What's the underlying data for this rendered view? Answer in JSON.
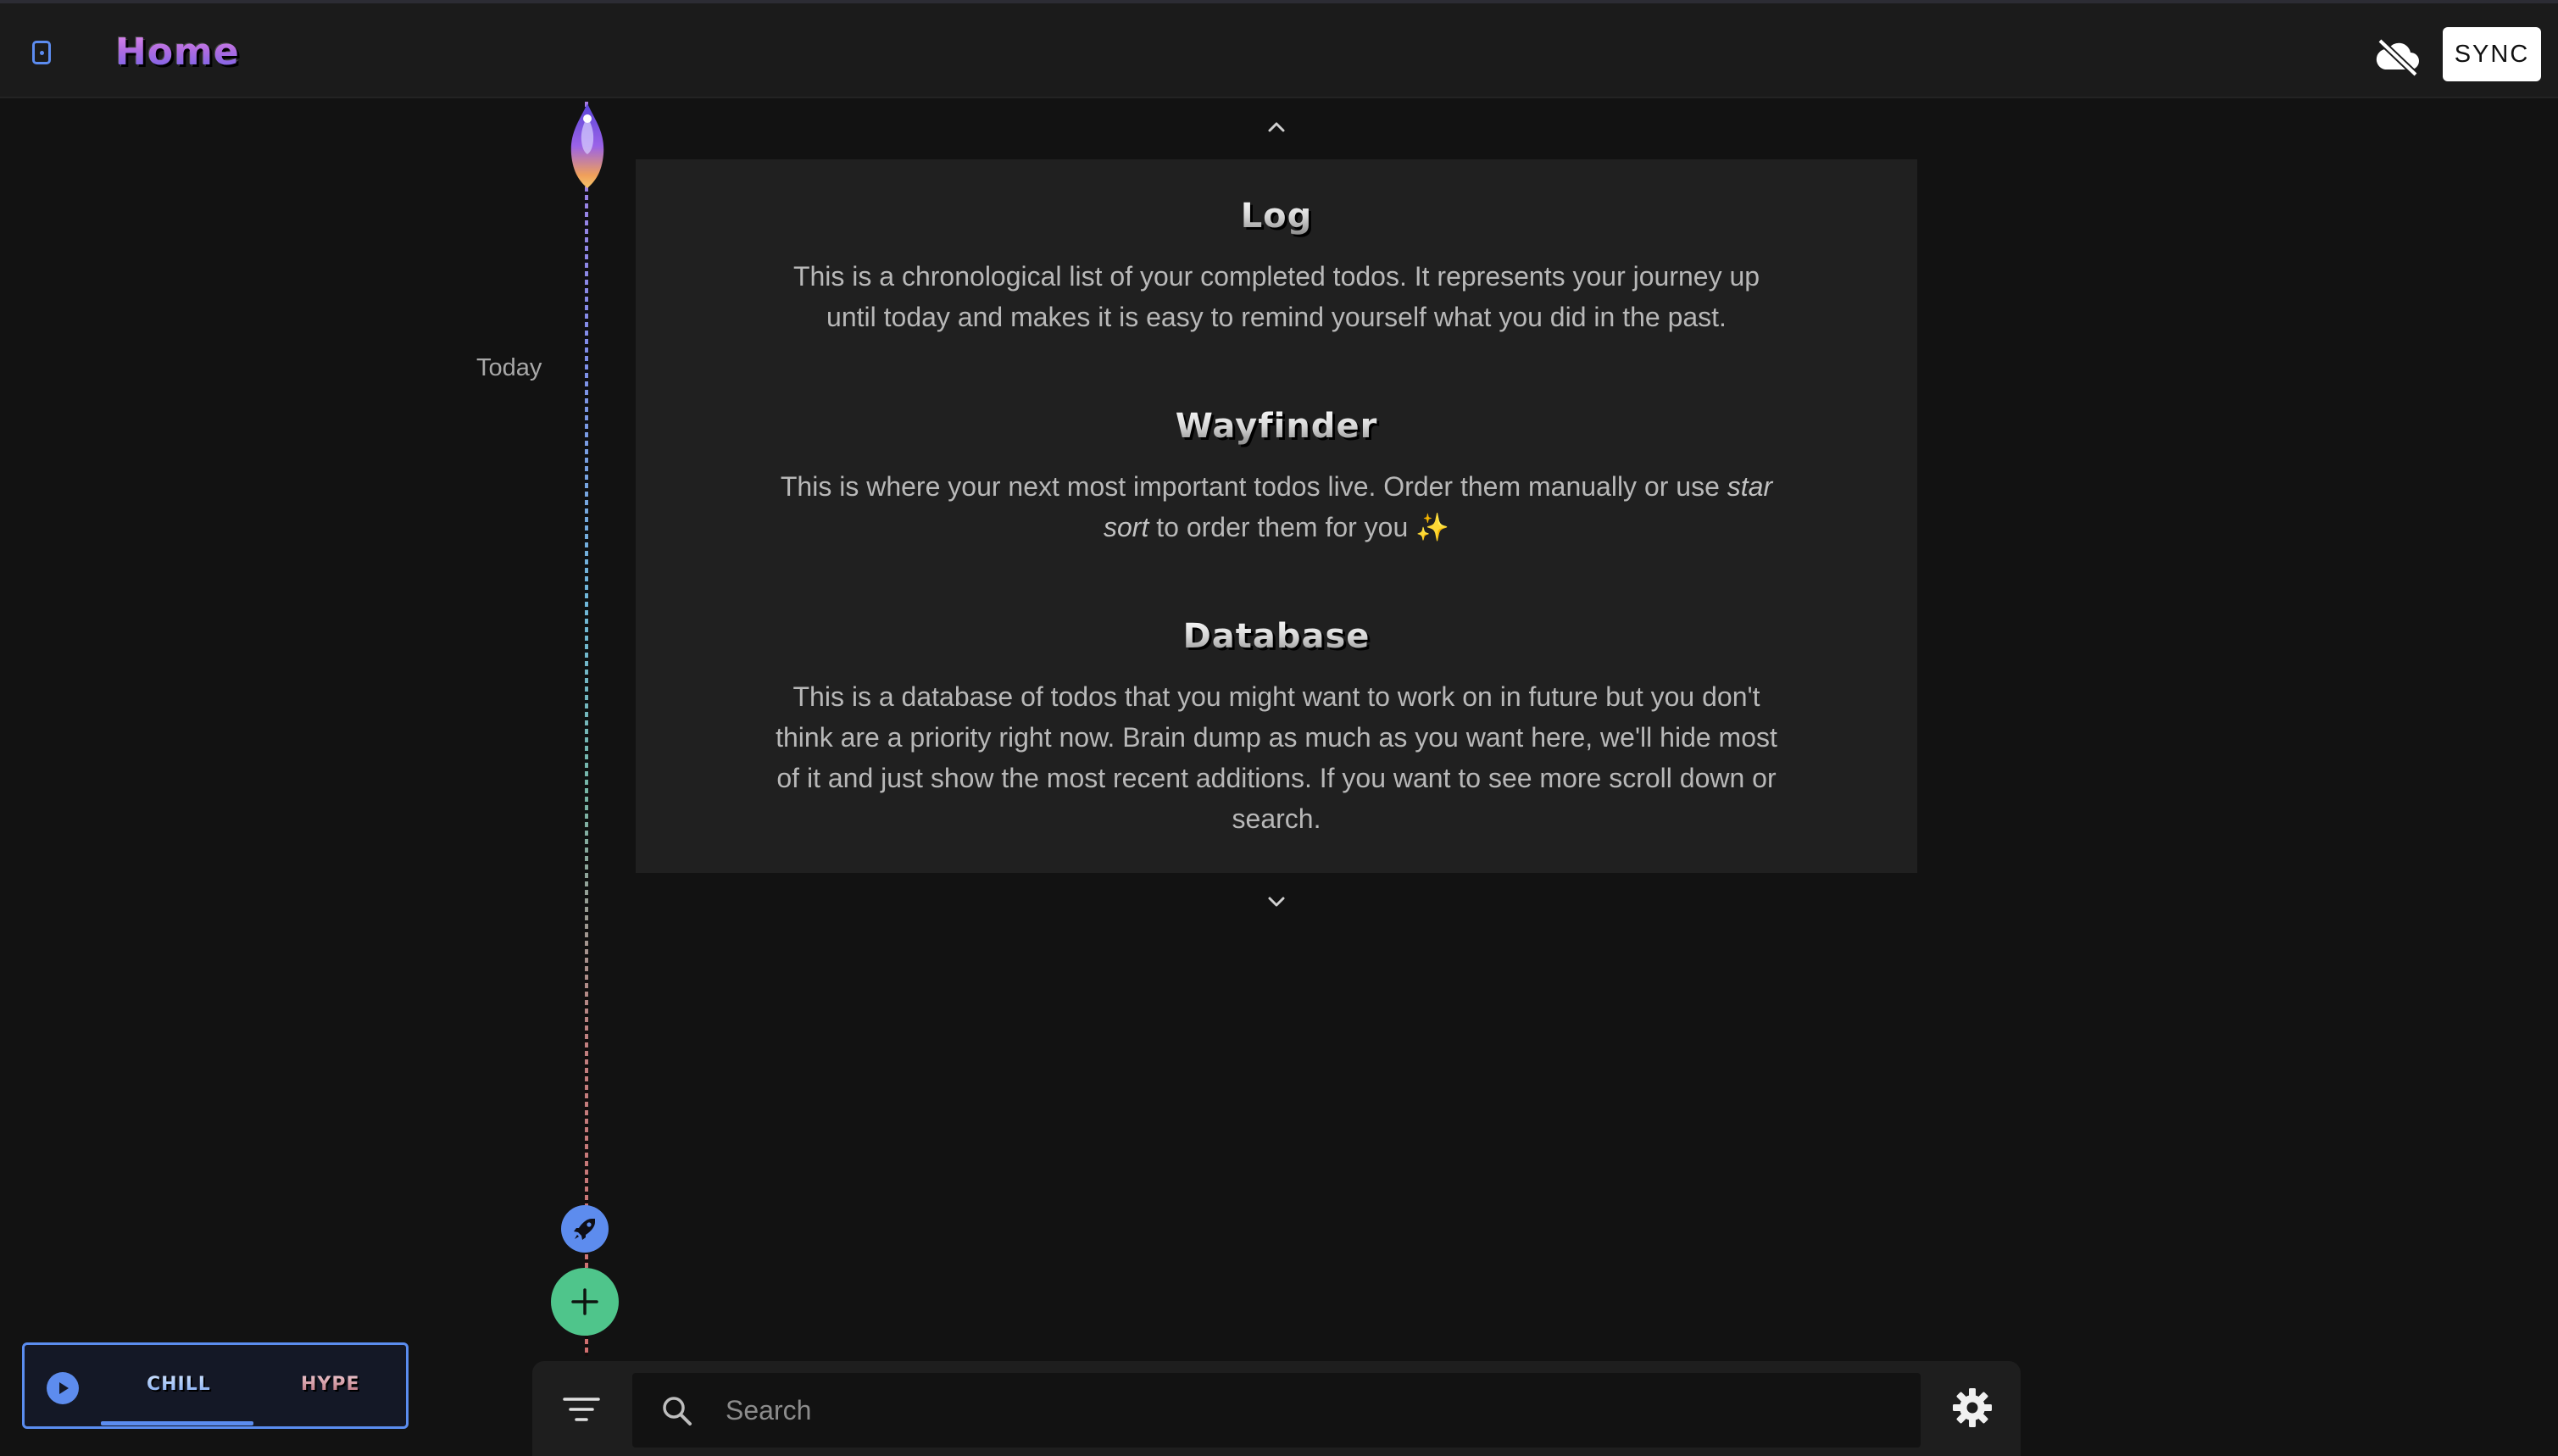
{
  "header": {
    "title": "Home",
    "sync_label": "SYNC",
    "icons": {
      "sidebar": "sidebar-toggle-icon",
      "cloud": "cloud-off-icon"
    }
  },
  "timeline": {
    "today_label": "Today",
    "top_icon": "flame-icon",
    "rocket_icon": "rocket-icon",
    "add_icon": "plus-icon"
  },
  "info": {
    "sections": [
      {
        "title": "Log",
        "body": "This is a chronological list of your completed todos. It represents your journey up until today and makes it is easy to remind yourself what you did in the past."
      },
      {
        "title": "Wayfinder",
        "body_before": "This is where your next most important todos live. Order them manually or use ",
        "body_emphasis": "star sort",
        "body_after": " to order them for you ✨"
      },
      {
        "title": "Database",
        "body": "This is a database of todos that you might want to work on in future but you don't think are a priority right now. Brain dump as much as you want here, we'll hide most of it and just show the most recent additions. If you want to see more scroll down or search."
      }
    ]
  },
  "music": {
    "modes": [
      "CHILL",
      "HYPE"
    ],
    "active_mode": "CHILL"
  },
  "bottom_bar": {
    "search_placeholder": "Search",
    "icons": {
      "filter": "filter-icon",
      "search": "search-icon",
      "settings": "gear-icon"
    }
  },
  "colors": {
    "accent_blue": "#5d8cee",
    "add_green": "#4fc58b",
    "background": "#121212",
    "panel": "#202020"
  }
}
